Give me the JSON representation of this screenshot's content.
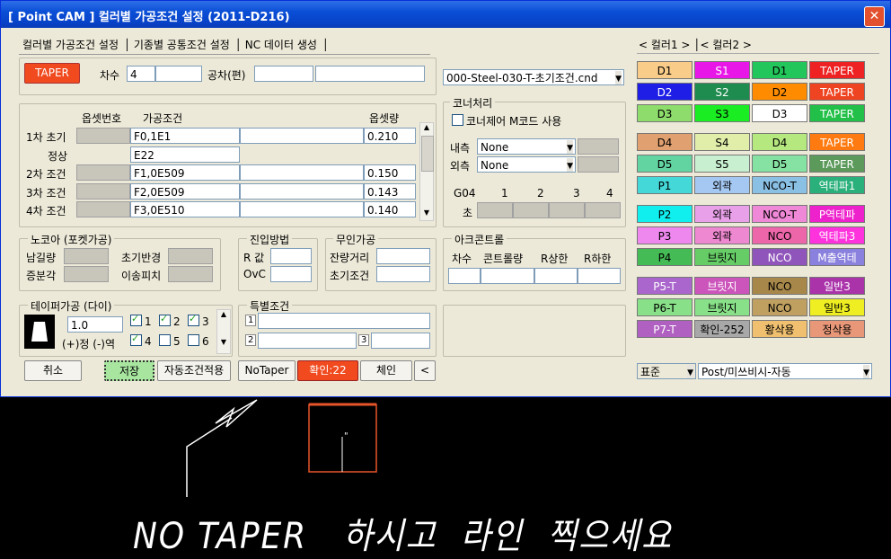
{
  "window": {
    "title": "[ Point CAM ]  컬러별 가공조건 설정  (2011-D216)",
    "close_glyph": "✕"
  },
  "tabs": [
    "컬러별 가공조건 설정",
    "기종별 공통조건 설정",
    "NC 데이터 생성"
  ],
  "top": {
    "taper_button": "TAPER",
    "order_label": "차수",
    "order_value": "4",
    "tolerance_label": "공차(편)",
    "condition_file": "000-Steel-030-T-초기조건.cnd"
  },
  "conditions": {
    "headers": {
      "offset_no": "옵셋번호",
      "condition": "가공조건",
      "offset": "옵셋량"
    },
    "rows": [
      {
        "label": "1차 초기",
        "condition": "F0,1E1",
        "offset": "0.210"
      },
      {
        "label": "정상",
        "condition": "E22",
        "offset": ""
      },
      {
        "label": "2차 조건",
        "condition": "F1,0E509",
        "offset": "0.150"
      },
      {
        "label": "3차 조건",
        "condition": "F2,0E509",
        "offset": "0.143"
      },
      {
        "label": "4차 조건",
        "condition": "F3,0E510",
        "offset": "0.140"
      }
    ]
  },
  "corner": {
    "title": "코너처리",
    "mcode_label": "코너제어 M코드 사용",
    "inner_label": "내측",
    "inner_value": "None",
    "outer_label": "외측",
    "outer_value": "None",
    "g04_label": "G04",
    "sec_label": "초",
    "cols": [
      "1",
      "2",
      "3",
      "4"
    ]
  },
  "nozzle": {
    "title": "노코아 (포켓가공)",
    "remain_angle": "남길량",
    "init_radius": "초기반경",
    "incr_angle": "증분각",
    "move_pitch": "이송피치"
  },
  "approach": {
    "title": "진입방법",
    "r_value": "R 값",
    "ovc": "OvC"
  },
  "unmanned": {
    "title": "무인가공",
    "remain_dist": "잔량거리",
    "init_cond": "초기조건"
  },
  "arc": {
    "title": "아크콘트롤",
    "cols": [
      "차수",
      "콘트롤량",
      "R상한",
      "R하한"
    ]
  },
  "taper": {
    "title": "테이퍼가공 (다이)",
    "value": "1.0",
    "direction_label": "(+)정  (-)역",
    "checks": [
      {
        "label": "1",
        "on": true
      },
      {
        "label": "2",
        "on": true
      },
      {
        "label": "3",
        "on": true
      },
      {
        "label": "4",
        "on": true
      },
      {
        "label": "5",
        "on": false
      },
      {
        "label": "6",
        "on": false
      }
    ]
  },
  "special": {
    "title": "특별조건",
    "nums": [
      "1",
      "2",
      "3"
    ]
  },
  "buttons": {
    "cancel": "취소",
    "save": "저장",
    "auto_apply": "자동조건적용",
    "no_taper": "NoTaper",
    "confirm": "확인:22",
    "chain": "체인",
    "back": "<"
  },
  "color_tabs": [
    "< 컬러1 >",
    "< 컬러2 >"
  ],
  "palette": [
    [
      {
        "t": "D1",
        "bg": "#f9cc8a"
      },
      {
        "t": "S1",
        "bg": "#e817e8"
      },
      {
        "t": "D1",
        "bg": "#22c65a"
      },
      {
        "t": "TAPER",
        "bg": "#ee2222"
      }
    ],
    [
      {
        "t": "D2",
        "bg": "#1e1ee6"
      },
      {
        "t": "S2",
        "bg": "#1e8c4e"
      },
      {
        "t": "D2",
        "bg": "#ff8c00"
      },
      {
        "t": "TAPER",
        "bg": "#ee4422"
      }
    ],
    [
      {
        "t": "D3",
        "bg": "#8edc6b"
      },
      {
        "t": "S3",
        "bg": "#1aee22"
      },
      {
        "t": "D3",
        "bg": "#ffffff"
      },
      {
        "t": "TAPER",
        "bg": "#22c048"
      }
    ],
    [
      {
        "t": "D4",
        "bg": "#e0a070"
      },
      {
        "t": "S4",
        "bg": "#e0eeaa"
      },
      {
        "t": "D4",
        "bg": "#b6e880"
      },
      {
        "t": "TAPER",
        "bg": "#ff7a10"
      }
    ],
    [
      {
        "t": "D5",
        "bg": "#62d4a2"
      },
      {
        "t": "S5",
        "bg": "#c8f0d0"
      },
      {
        "t": "D5",
        "bg": "#86e2a2"
      },
      {
        "t": "TAPER",
        "bg": "#5b9a5a"
      }
    ],
    [
      {
        "t": "P1",
        "bg": "#44d8d8"
      },
      {
        "t": "외곽",
        "bg": "#a4c8f2"
      },
      {
        "t": "NCO-T",
        "bg": "#8ac0e4"
      },
      {
        "t": "역테파1",
        "bg": "#2ab07a"
      }
    ],
    [
      {
        "t": "P2",
        "bg": "#11eeee"
      },
      {
        "t": "외곽",
        "bg": "#e8a0e8"
      },
      {
        "t": "NCO-T",
        "bg": "#f088d8"
      },
      {
        "t": "P역테파",
        "bg": "#ee22cc"
      }
    ],
    [
      {
        "t": "P3",
        "bg": "#ee88ee"
      },
      {
        "t": "외곽",
        "bg": "#ee88d0"
      },
      {
        "t": "NCO",
        "bg": "#ee66aa"
      },
      {
        "t": "역테파3",
        "bg": "#ff33dd"
      }
    ],
    [
      {
        "t": "P4",
        "bg": "#44bb55"
      },
      {
        "t": "브릿지",
        "bg": "#66cc66"
      },
      {
        "t": "NCO",
        "bg": "#9055bb"
      },
      {
        "t": "M출역테",
        "bg": "#8a80dd"
      }
    ],
    [
      {
        "t": "P5-T",
        "bg": "#aa66cc"
      },
      {
        "t": "브릿지",
        "bg": "#cc55bb"
      },
      {
        "t": "NCO",
        "bg": "#a8884a"
      },
      {
        "t": "일반3",
        "bg": "#aa33aa"
      }
    ],
    [
      {
        "t": "P6-T",
        "bg": "#88e088"
      },
      {
        "t": "브릿지",
        "bg": "#88e088"
      },
      {
        "t": "NCO",
        "bg": "#c0a060"
      },
      {
        "t": "일반3",
        "bg": "#eeee22"
      }
    ],
    [
      {
        "t": "P7-T",
        "bg": "#b060c0"
      },
      {
        "t": "확인-252",
        "bg": "#a8a8a8"
      },
      {
        "t": "황삭용",
        "bg": "#f0c070"
      },
      {
        "t": "정삭용",
        "bg": "#e89878"
      }
    ]
  ],
  "bottom_right": {
    "mode": "표준",
    "post": "Post/미쓰비시-자동"
  },
  "cad_note": "NO TAPER   하시고  라인  찍으세요"
}
